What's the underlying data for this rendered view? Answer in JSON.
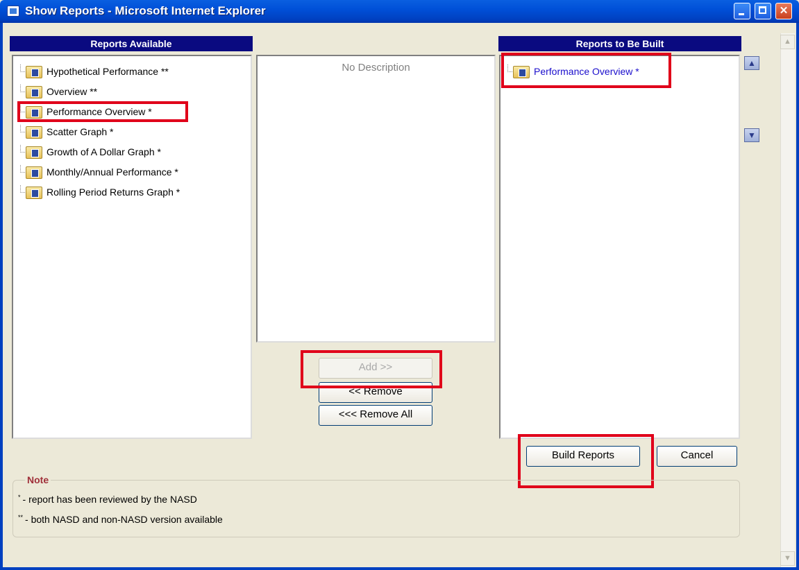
{
  "window": {
    "title": "Show Reports - Microsoft Internet Explorer",
    "minimize_glyph": "",
    "maximize_glyph": "",
    "close_glyph": "✕"
  },
  "available": {
    "header": "Reports Available",
    "items": [
      {
        "label": "Hypothetical Performance **"
      },
      {
        "label": "Overview **"
      },
      {
        "label": "Performance Overview *"
      },
      {
        "label": "Scatter Graph *"
      },
      {
        "label": "Growth of A Dollar Graph *"
      },
      {
        "label": "Monthly/Annual Performance *"
      },
      {
        "label": "Rolling Period Returns Graph *"
      }
    ]
  },
  "description": {
    "text": "No Description"
  },
  "buttons": {
    "add": "Add >>",
    "remove": "<< Remove",
    "remove_all": "<<< Remove All",
    "build": "Build Reports",
    "cancel": "Cancel"
  },
  "selected": {
    "header": "Reports to Be Built",
    "items": [
      {
        "label": "Performance Overview *"
      }
    ]
  },
  "order": {
    "up_glyph": "▲",
    "down_glyph": "▼"
  },
  "note": {
    "legend": "Note",
    "lines": [
      {
        "mark": "*",
        "text": "- report has been reviewed by the NASD"
      },
      {
        "mark": "**",
        "text": "- both NASD and non-NASD version available"
      }
    ]
  },
  "scrollbar": {
    "up_glyph": "▲",
    "down_glyph": "▼"
  },
  "colors": {
    "header_bg": "#0A0A80",
    "highlight": "#E0001A",
    "titlebar": "#0050D8",
    "selected_text": "#1A0DCC"
  }
}
